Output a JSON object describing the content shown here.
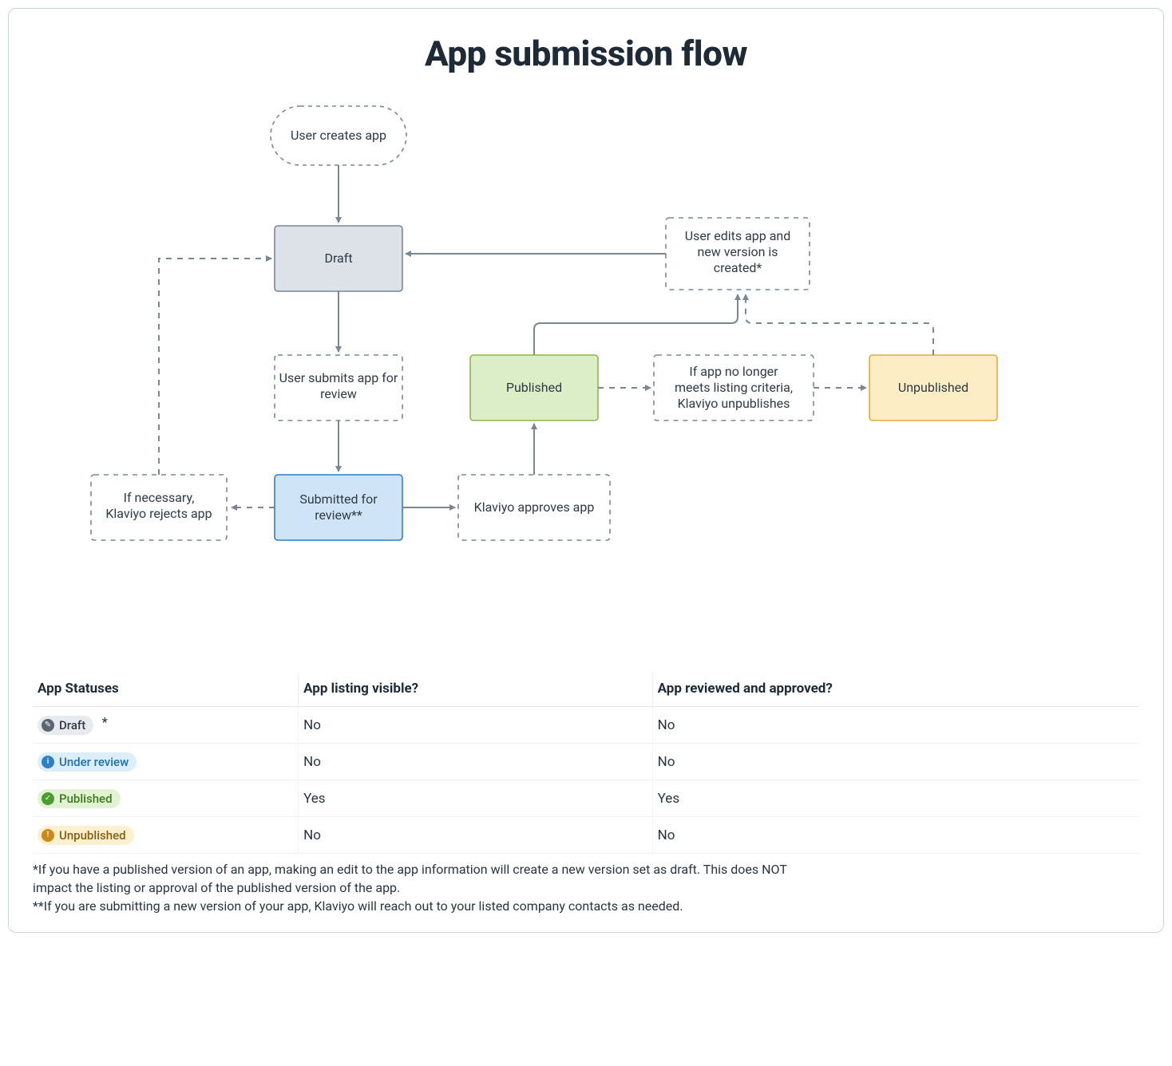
{
  "title": "App submission flow",
  "nodes": {
    "user_creates": {
      "bold": "User",
      "rest": " creates app"
    },
    "draft": "Draft",
    "user_submits": {
      "bold": "User",
      "rest": " submits app for",
      "line2": "review"
    },
    "submitted": {
      "line1": "Submitted for",
      "line2": "review**"
    },
    "klaviyo_rejects": {
      "line1": "If necessary,",
      "bold": "Klaviyo",
      "rest": " rejects app"
    },
    "klaviyo_approves": {
      "bold": "Klaviyo",
      "rest": " approves app"
    },
    "published": "Published",
    "unpub_action": {
      "line1": "If app no longer",
      "line2a": "meets listing criteria,",
      "bold": "Klaviyo",
      "rest": " unpublishes"
    },
    "unpublished": "Unpublished",
    "user_edits": {
      "bold": "User",
      "rest": " edits app and",
      "line2": "new version is",
      "line3": "created*"
    }
  },
  "table": {
    "headers": [
      "App Statuses",
      "App listing visible?",
      "App reviewed and approved?"
    ],
    "rows": [
      {
        "status": "Draft",
        "badge": "gray",
        "icon": "pencil",
        "star": "*",
        "visible": "No",
        "approved": "No"
      },
      {
        "status": "Under review",
        "badge": "blue",
        "icon": "info",
        "visible": "No",
        "approved": "No"
      },
      {
        "status": "Published",
        "badge": "green",
        "icon": "check",
        "visible": "Yes",
        "approved": "Yes"
      },
      {
        "status": "Unpublished",
        "badge": "amber",
        "icon": "bang",
        "visible": "No",
        "approved": "No"
      }
    ]
  },
  "footnotes": {
    "f1": "*If you have a published version of an app, making an edit to the app information will create a new version set as draft. This does NOT impact the listing or approval of the published version of the app.",
    "f2": "**If you are submitting a new version of your app, Klaviyo will reach out to your listed company contacts as needed."
  }
}
